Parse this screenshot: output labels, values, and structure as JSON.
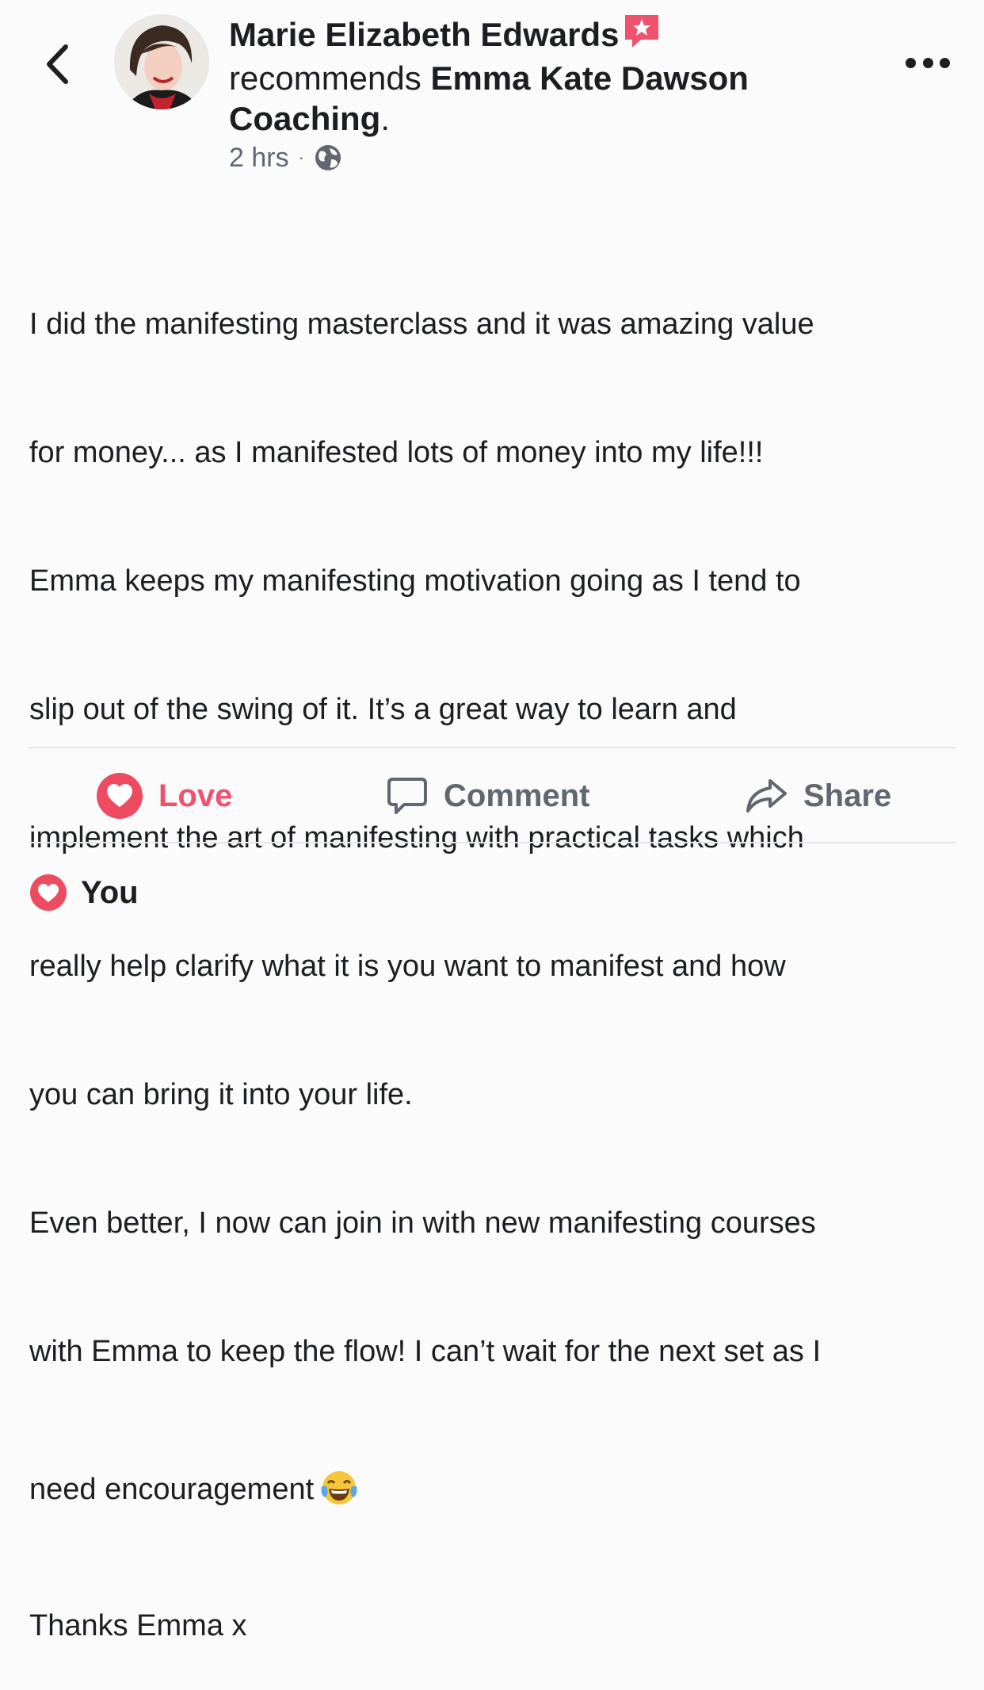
{
  "header": {
    "back_icon": "chevron-left-icon",
    "author_name": "Marie Elizabeth Edwards",
    "recommendation_icon": "recommendation-star-icon",
    "recommends_text": "recommends",
    "page_name": "Emma Kate Dawson Coaching",
    "punctuation": ".",
    "time": "2 hrs",
    "separator": "·",
    "privacy_icon": "globe-icon",
    "more_icon": "more-options-icon"
  },
  "post": {
    "lines": [
      "I did the manifesting masterclass and it was amazing value",
      "for money... as I manifested lots of money into my life!!!",
      "Emma keeps my manifesting motivation going as I tend to",
      "slip out of the swing of it. It’s a great way to learn and",
      "implement the art of manifesting with practical tasks which",
      "really help clarify what it is you want to manifest and how",
      "you can bring it into your life.",
      "Even better, I now can join in with new manifesting courses",
      "with Emma to keep the flow! I can’t wait for the next set as I",
      "need encouragement",
      "Thanks Emma x"
    ],
    "emoji_icon": "tears-of-joy-emoji"
  },
  "actions": {
    "love_label": "Love",
    "comment_label": "Comment",
    "share_label": "Share"
  },
  "reactions": {
    "summary_label": "You"
  },
  "colors": {
    "love": "#f0526e",
    "secondary_text": "#606770",
    "primary_text": "#1c1e21"
  }
}
